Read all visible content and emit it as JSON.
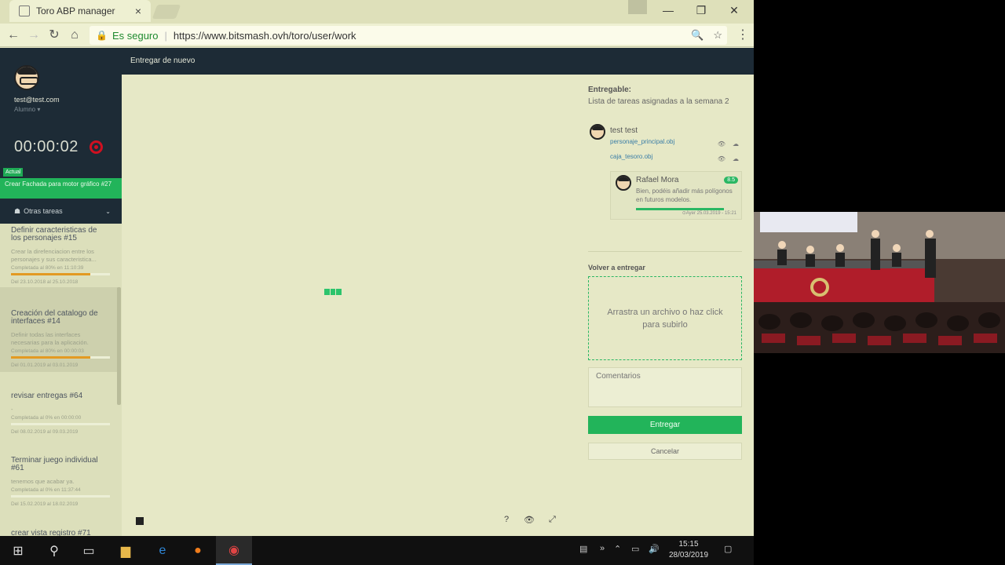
{
  "browser": {
    "tab_title": "Toro ABP manager",
    "tab_close": "×",
    "secure_label": "Es seguro",
    "url": "https://www.bitsmash.ovh/toro/user/work"
  },
  "sidebar": {
    "email": "test@test.com",
    "role": "Alumno ▾",
    "timer": "00:00:02",
    "actual_badge": "Actual",
    "current_task": "Crear Fachada para motor gráfico #27",
    "other_tasks_label": "Otras tareas",
    "tasks": [
      {
        "title": "Definir caracteristicas de los personajes #15",
        "desc": "Crear la direfenciacion entre los personajes y sus caracteristica...",
        "progress_text": "Completada al 80% en 11:10:39",
        "progress": 0.8,
        "dates": "Del 23.10.2018 al 25.10.2018"
      },
      {
        "title": "Creación del catalogo de interfaces #14",
        "desc": "Definir todas las interfaces necesarias para la aplicación.",
        "progress_text": "Completada al 80% en 00:00:03",
        "progress": 0.8,
        "dates": "Del 01.01.2019 al 03.01.2019"
      },
      {
        "title": "revisar entregas #64",
        "desc": "-",
        "progress_text": "Completada al 0% en 00:00:00",
        "progress": 0,
        "dates": "Del 08.02.2019 al 09.03.2019"
      },
      {
        "title": "Terminar juego individual #61",
        "desc": "tenemos que acabar ya.",
        "progress_text": "Completada al 0% en 11:37:44",
        "progress": 0,
        "dates": "Del 15.02.2019 al 18.02.2019"
      },
      {
        "title": "crear vista registro #71",
        "desc": "",
        "progress_text": "",
        "progress": 0,
        "dates": ""
      }
    ]
  },
  "header": {
    "title": "Entregar de nuevo"
  },
  "panel": {
    "deliverable_label": "Entregable:",
    "deliverable_value": "Lista de tareas asignadas a la semana 2",
    "submitter": "test test",
    "files": [
      "personaje_principal.obj",
      "caja_tesoro.obj"
    ],
    "reviewer": "Rafael Mora",
    "grade": "8.5",
    "review_comment": "Bien, podéis añadir más polígonos en futuros modelos.",
    "review_progress": 1.0,
    "review_date": "⊙Ayer 25.03.2019 - 15:21",
    "resend_label": "Volver a entregar",
    "dropzone_text": "Arrastra un archivo o haz click para subirlo",
    "comments_placeholder": "Comentarios",
    "submit_label": "Entregar",
    "cancel_label": "Cancelar"
  },
  "bottom": {
    "help": "?",
    "eye": "👁",
    "expand": "⤢"
  },
  "taskbar": {
    "time": "15:15",
    "date": "28/03/2019"
  },
  "colors": {
    "accent_green": "#22b45a",
    "dark_header": "#1d2b36",
    "progress_orange": "#e39a22"
  }
}
